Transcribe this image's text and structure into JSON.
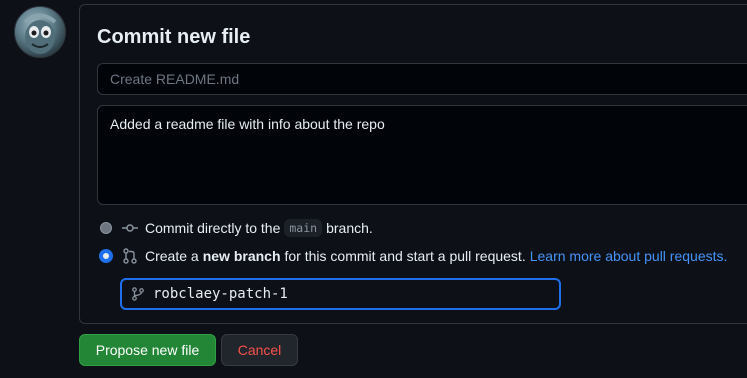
{
  "avatar": {
    "icon": "user-avatar"
  },
  "form": {
    "title": "Commit new file",
    "summary_placeholder": "Create README.md",
    "summary_value": "",
    "description_value": "Added a readme file with info about the repo"
  },
  "options": {
    "direct": {
      "selected": false,
      "icon": "git-commit-icon",
      "prefix": "Commit directly to the",
      "branch": "main",
      "suffix": "branch."
    },
    "new_branch": {
      "selected": true,
      "icon": "git-pull-request-icon",
      "prefix": "Create a",
      "bold": "new branch",
      "suffix": "for this commit and start a pull request.",
      "link": "Learn more about pull requests."
    }
  },
  "branch_field": {
    "icon": "git-branch-icon",
    "value": "robclaey-patch-1"
  },
  "buttons": {
    "propose": "Propose new file",
    "cancel": "Cancel"
  },
  "colors": {
    "background": "#0d1117",
    "border": "#30363d",
    "accent_blue": "#1f6feb",
    "link": "#4493f8",
    "primary_green": "#238636",
    "danger_red": "#f85149"
  }
}
